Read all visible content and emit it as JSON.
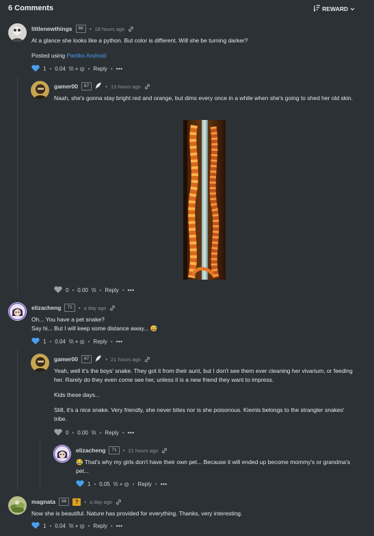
{
  "header": {
    "title": "6 Comments",
    "sort_label": "REWARD"
  },
  "comments": [
    {
      "author": "littlenewthings",
      "rep": "66",
      "time": "18 hours ago",
      "lines": [
        "At a glance she looks like a python. But color is different. Will she be turning darker?"
      ],
      "posted_prefix": "Posted using ",
      "posted_app": "Partiko Android",
      "votes": "1",
      "payout": "0.04",
      "reply": "Reply"
    },
    {
      "author": "gamer00",
      "rep": "67",
      "time": "13 hours ago",
      "lines": [
        "Naah, she's gonna stay bright red and orange, but dims every once in a while when she's going to shed her old skin."
      ],
      "votes": "0",
      "payout": "0.00",
      "reply": "Reply"
    },
    {
      "author": "elizacheng",
      "rep": "71",
      "time": "a day ago",
      "lines": [
        "Oh... You have a pet snake?",
        "Say hi... But I will keep some distance away... 😅"
      ],
      "votes": "1",
      "payout": "0.04",
      "reply": "Reply"
    },
    {
      "author": "gamer00",
      "rep": "67",
      "time": "21 hours ago",
      "lines": [
        "Yeah, well it's the boys' snake. They got it from their aunt, but I don't see them ever cleaning her vivarium, or feeding her. Rarely do they even come see her, unless it is a new friend they want to impress.",
        "Kids these days...",
        "Still, it's a nice snake. Very friendly, she never bites nor is she poisonous. Kiemis belongs to the strangler snakes' tribe."
      ],
      "votes": "0",
      "payout": "0.00",
      "reply": "Reply"
    },
    {
      "author": "elizacheng",
      "rep": "71",
      "time": "21 hours ago",
      "lines": [
        "😂 That's why my girls don't have their own pet... Because it will ended up become mommy's or grandma's pet..."
      ],
      "votes": "1",
      "payout": "0.05",
      "reply": "Reply"
    },
    {
      "author": "magnata",
      "rep": "66",
      "badge": "?",
      "time": "a day ago",
      "lines": [
        "Now she is beautiful. Nature has provided for everything. Thanks, very interesting."
      ],
      "votes": "1",
      "payout": "0.04",
      "reply": "Reply"
    }
  ],
  "icons": {
    "heart_liked": "heart-filled-icon",
    "heart_neutral": "heart-outline-icon",
    "link": "link-icon",
    "feather": "feather-icon",
    "more": "•••"
  },
  "colors": {
    "background": "#2c3136",
    "accent": "#4a9ff0",
    "text": "#e7e9ec",
    "muted": "#8e949a"
  }
}
